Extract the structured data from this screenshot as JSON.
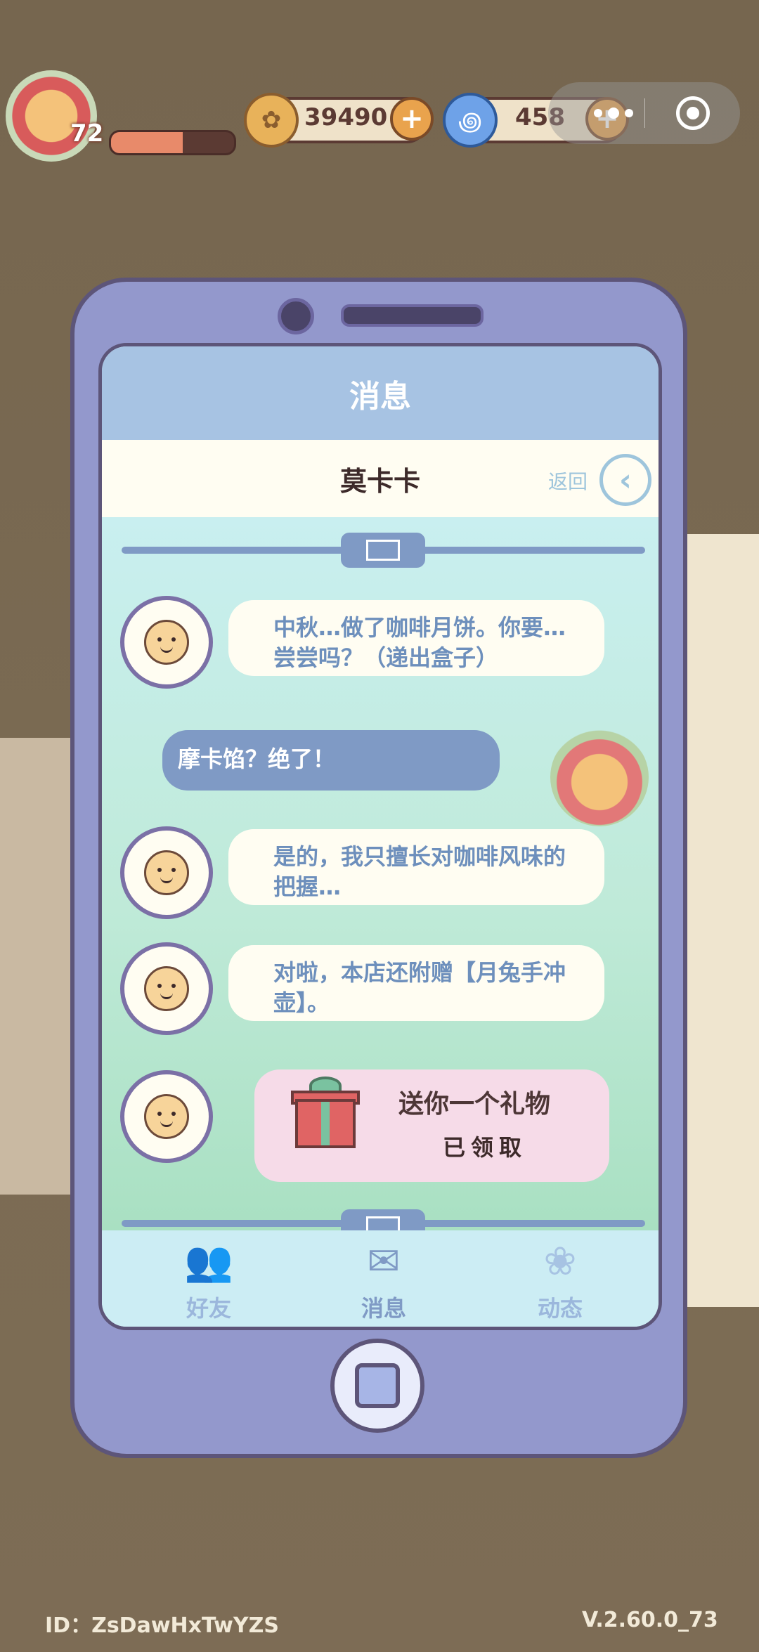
{
  "hud": {
    "level": "72",
    "xp_fraction": 0.58,
    "coins": "39490",
    "gems": "458",
    "coin_add_label": "+",
    "gem_add_label": "+"
  },
  "window": {
    "title": "消息",
    "contact_name": "莫卡卡",
    "back_label": "返回",
    "back_icon": "‹"
  },
  "messages": [
    {
      "side": "left",
      "text": "中秋…做了咖啡月饼。你要…尝尝吗？（递出盒子）"
    },
    {
      "side": "right",
      "text": "摩卡馅？绝了！"
    },
    {
      "side": "left",
      "text": "是的，我只擅长对咖啡风味的把握…"
    },
    {
      "side": "left",
      "text": "对啦，本店还附赠【月兔手冲壶】。"
    }
  ],
  "gift": {
    "title": "送你一个礼物",
    "status": "已领取"
  },
  "tabs": [
    {
      "label": "好友",
      "icon": "friends-icon",
      "glyph": "👥"
    },
    {
      "label": "消息",
      "icon": "mail-icon",
      "glyph": "✉"
    },
    {
      "label": "动态",
      "icon": "moments-icon",
      "glyph": "❀"
    }
  ],
  "footer": {
    "id_text": "ID：ZsDawHxTwYZS",
    "version": "V.2.60.0_73"
  },
  "colors": {
    "phone": "#9398cc",
    "accent": "#7f9ac5",
    "header": "#a7c3e3"
  }
}
